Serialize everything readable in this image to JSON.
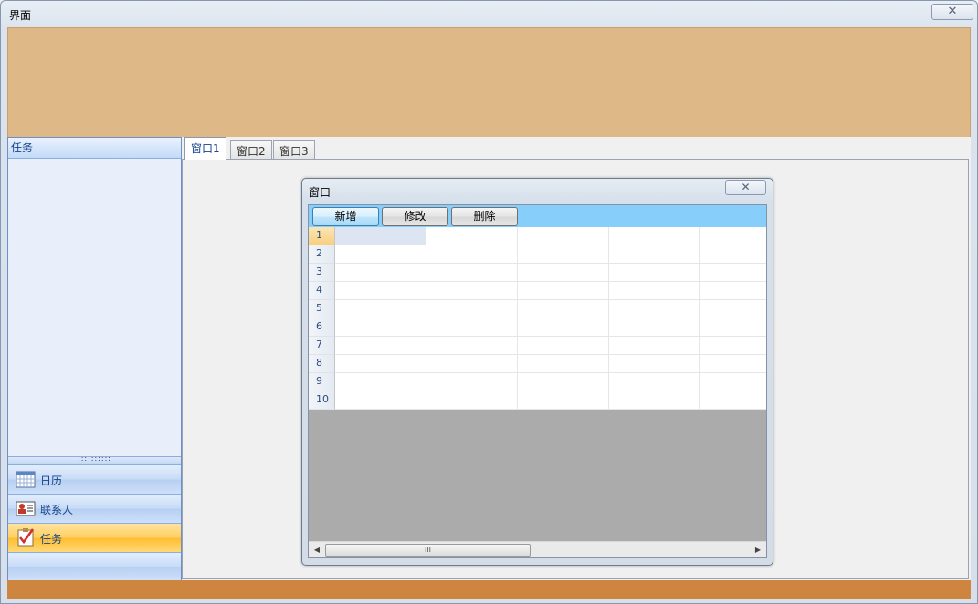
{
  "window": {
    "title": "界面",
    "close_glyph": "✕"
  },
  "colors": {
    "banner": "#deb887",
    "status_strip": "#cd853f",
    "toolbar": "#87cefa"
  },
  "sidebar": {
    "header": "任务",
    "splitter_glyph": "::::::::::",
    "nav": [
      {
        "label": "日历",
        "icon": "calendar-icon",
        "selected": false
      },
      {
        "label": "联系人",
        "icon": "contact-card-icon",
        "selected": false
      },
      {
        "label": "任务",
        "icon": "task-checklist-icon",
        "selected": true
      }
    ]
  },
  "tabs": [
    {
      "label": "窗口1",
      "active": true
    },
    {
      "label": "窗口2",
      "active": false
    },
    {
      "label": "窗口3",
      "active": false
    }
  ],
  "inner_window": {
    "title": "窗口",
    "close_glyph": "✕",
    "toolbar": {
      "add_label": "新增",
      "edit_label": "修改",
      "delete_label": "删除"
    },
    "grid": {
      "rows": [
        "1",
        "2",
        "3",
        "4",
        "5",
        "6",
        "7",
        "8",
        "9",
        "10"
      ],
      "column_count": 5,
      "current_row": "1"
    },
    "scrollbar": {
      "left_glyph": "◀",
      "right_glyph": "▶",
      "thumb_glyph": "III"
    }
  }
}
